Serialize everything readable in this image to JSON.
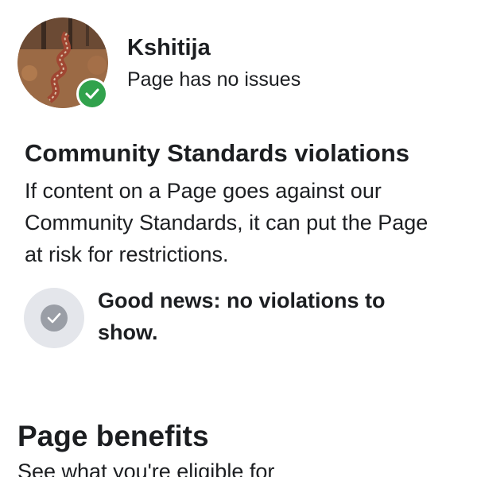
{
  "profile": {
    "name": "Kshitija",
    "status": "Page has no issues"
  },
  "community_standards": {
    "title": "Community Standards violations",
    "body": "If content on a Page goes against our Community Standards, it can put the Page at risk for restrictions.",
    "good_news": "Good news: no violations to show."
  },
  "page_benefits": {
    "title": "Page benefits",
    "subtitle": "See what you're eligible for"
  },
  "colors": {
    "verified_badge": "#31a24c",
    "check_circle_bg": "#e4e6eb",
    "check_inner": "#9a9ea6",
    "text": "#1c1e21"
  },
  "icons": {
    "badge": "check-icon",
    "good_news": "check-circle-icon"
  }
}
